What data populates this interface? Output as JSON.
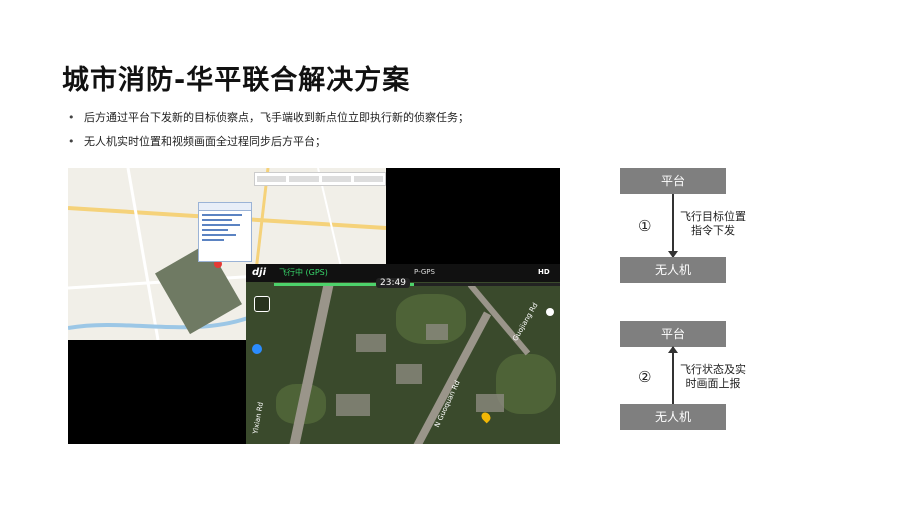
{
  "title": "城市消防-华平联合解决方案",
  "bullets": [
    "后方通过平台下发新的目标侦察点，飞手端收到新点位立即执行新的侦察任务；",
    "无人机实时位置和视频画面全过程同步后方平台；"
  ],
  "screenshot": {
    "drone": {
      "logo": "dji",
      "status": "飞行中 (GPS)",
      "gps": "P-GPS",
      "timer": "23:49",
      "hd": "HD",
      "streets": [
        "Guojiang Rd",
        "N Guoquan Rd",
        "Yixian Rd"
      ]
    }
  },
  "diagram": {
    "top": {
      "platform": "平台",
      "drone": "无人机",
      "number": "①",
      "note": "飞行目标位置指令下发"
    },
    "bottom": {
      "platform": "平台",
      "drone": "无人机",
      "number": "②",
      "note": "飞行状态及实时画面上报"
    }
  }
}
